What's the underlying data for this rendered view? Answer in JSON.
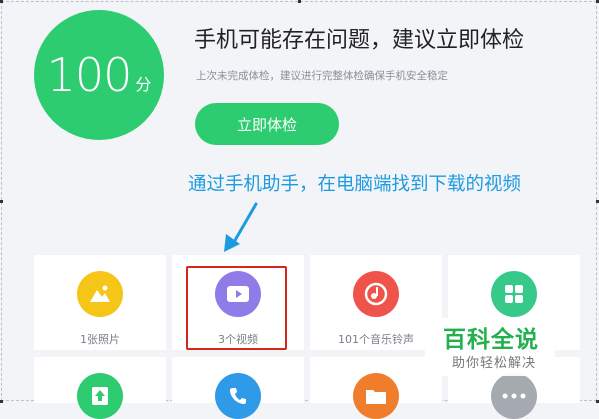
{
  "score": {
    "value": "100",
    "unit": "分"
  },
  "status": {
    "headline": "手机可能存在问题，建议立即体检",
    "subline": "上次未完成体检，建议进行完整体检确保手机安全稳定"
  },
  "check_button": {
    "label": "立即体检"
  },
  "annotation": {
    "text": "通过手机助手，在电脑端找到下载的视频"
  },
  "tiles": [
    {
      "label": "1张照片",
      "icon": "photo-icon",
      "color": "#f5c518"
    },
    {
      "label": "3个视频",
      "icon": "video-icon",
      "color": "#8f7ce8"
    },
    {
      "label": "101个音乐铃声",
      "icon": "music-icon",
      "color": "#f0534a"
    },
    {
      "label": "",
      "icon": "apps-icon",
      "color": "#37c98a"
    },
    {
      "label": "",
      "icon": "download-icon",
      "color": "#2ecc71"
    },
    {
      "label": "",
      "icon": "phone-icon",
      "color": "#2f9be8"
    },
    {
      "label": "",
      "icon": "folder-icon",
      "color": "#f07d2b"
    },
    {
      "label": "",
      "icon": "more-icon",
      "color": "#a5a9b0"
    }
  ],
  "watermark": {
    "title": "百科全说",
    "subtitle": "助你轻松解决"
  }
}
